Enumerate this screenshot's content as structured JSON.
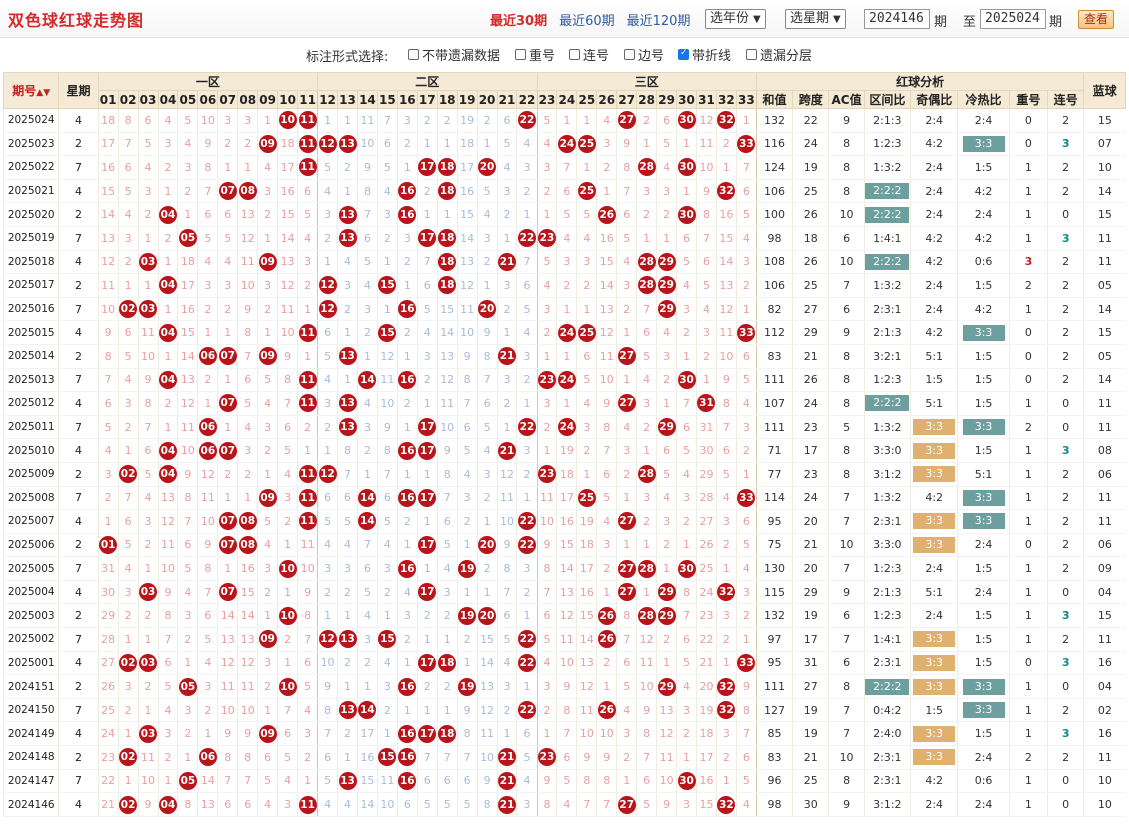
{
  "title": "双色球红球走势图",
  "toplinks": [
    "最近30期",
    "最近60期",
    "最近120期"
  ],
  "year_select": "选年份",
  "week_select": "选星期",
  "from_issue": "2024146",
  "issue_suffix": "期",
  "to_label": "至",
  "to_issue": "2025024",
  "view_button": "查看",
  "options_label": "标注形式选择:",
  "options": [
    {
      "label": "不带遗漏数据",
      "checked": false
    },
    {
      "label": "重号",
      "checked": false
    },
    {
      "label": "连号",
      "checked": false
    },
    {
      "label": "边号",
      "checked": false
    },
    {
      "label": "带折线",
      "checked": true
    },
    {
      "label": "遗漏分层",
      "checked": false
    }
  ],
  "headers": {
    "issue": "期号",
    "week": "星期",
    "zone1": "一区",
    "zone2": "二区",
    "zone3": "三区",
    "analysis": "红球分析",
    "blue": "蓝球",
    "an_cols": [
      "和值",
      "跨度",
      "AC值",
      "区间比",
      "奇偶比",
      "冷热比",
      "重号",
      "连号"
    ]
  },
  "rows": [
    {
      "issue": "2025024",
      "week": "4",
      "red": [
        10,
        11,
        22,
        27,
        30,
        32
      ],
      "sum": "132",
      "span": "22",
      "ac": "9",
      "zone": "2:1:3",
      "oe": "2:4",
      "ch": "2:4",
      "rep": "0",
      "con": "2",
      "blue": "15"
    },
    {
      "issue": "2025023",
      "week": "2",
      "red": [
        9,
        11,
        12,
        13,
        24,
        25,
        33
      ],
      "sum": "116",
      "span": "24",
      "ac": "8",
      "zone": "1:2:3",
      "oe": "4:2",
      "ch": "3:3",
      "rep": "0",
      "con": "3",
      "blue": "07"
    },
    {
      "issue": "2025022",
      "week": "7",
      "red": [
        11,
        17,
        18,
        20,
        28,
        30
      ],
      "sum": "124",
      "span": "19",
      "ac": "8",
      "zone": "1:3:2",
      "oe": "2:4",
      "ch": "1:5",
      "rep": "1",
      "con": "2",
      "blue": "10"
    },
    {
      "issue": "2025021",
      "week": "4",
      "red": [
        7,
        8,
        16,
        18,
        25,
        32
      ],
      "sum": "106",
      "span": "25",
      "ac": "8",
      "zone": "2:2:2",
      "oe": "2:4",
      "ch": "4:2",
      "rep": "1",
      "con": "2",
      "blue": "14"
    },
    {
      "issue": "2025020",
      "week": "2",
      "red": [
        4,
        13,
        16,
        26,
        30
      ],
      "sum": "100",
      "span": "26",
      "ac": "10",
      "zone": "2:2:2",
      "oe": "2:4",
      "ch": "2:4",
      "rep": "1",
      "con": "0",
      "blue": "15"
    },
    {
      "issue": "2025019",
      "week": "7",
      "red": [
        5,
        13,
        17,
        18,
        22,
        23
      ],
      "sum": "98",
      "span": "18",
      "ac": "6",
      "zone": "1:4:1",
      "oe": "4:2",
      "ch": "4:2",
      "rep": "1",
      "con": "3",
      "blue": "11"
    },
    {
      "issue": "2025018",
      "week": "4",
      "red": [
        3,
        9,
        18,
        21,
        28,
        29
      ],
      "sum": "108",
      "span": "26",
      "ac": "10",
      "zone": "2:2:2",
      "oe": "4:2",
      "ch": "0:6",
      "rep": "3",
      "con": "2",
      "blue": "11"
    },
    {
      "issue": "2025017",
      "week": "2",
      "red": [
        4,
        12,
        15,
        18,
        28,
        29
      ],
      "sum": "106",
      "span": "25",
      "ac": "7",
      "zone": "1:3:2",
      "oe": "2:4",
      "ch": "1:5",
      "rep": "2",
      "con": "2",
      "blue": "05"
    },
    {
      "issue": "2025016",
      "week": "7",
      "red": [
        2,
        3,
        12,
        16,
        20,
        29
      ],
      "sum": "82",
      "span": "27",
      "ac": "6",
      "zone": "2:3:1",
      "oe": "2:4",
      "ch": "4:2",
      "rep": "1",
      "con": "2",
      "blue": "14"
    },
    {
      "issue": "2025015",
      "week": "4",
      "red": [
        4,
        11,
        15,
        24,
        25,
        33
      ],
      "sum": "112",
      "span": "29",
      "ac": "9",
      "zone": "2:1:3",
      "oe": "4:2",
      "ch": "3:3",
      "rep": "0",
      "con": "2",
      "blue": "15"
    },
    {
      "issue": "2025014",
      "week": "2",
      "red": [
        6,
        7,
        9,
        13,
        21,
        27
      ],
      "sum": "83",
      "span": "21",
      "ac": "8",
      "zone": "3:2:1",
      "oe": "5:1",
      "ch": "1:5",
      "rep": "0",
      "con": "2",
      "blue": "05"
    },
    {
      "issue": "2025013",
      "week": "7",
      "red": [
        4,
        11,
        14,
        16,
        23,
        24,
        30
      ],
      "sum": "111",
      "span": "26",
      "ac": "8",
      "zone": "1:2:3",
      "oe": "1:5",
      "ch": "1:5",
      "rep": "0",
      "con": "2",
      "blue": "14"
    },
    {
      "issue": "2025012",
      "week": "4",
      "red": [
        7,
        11,
        13,
        27,
        31
      ],
      "sum": "107",
      "span": "24",
      "ac": "8",
      "zone": "2:2:2",
      "oe": "5:1",
      "ch": "1:5",
      "rep": "1",
      "con": "0",
      "blue": "11"
    },
    {
      "issue": "2025011",
      "week": "7",
      "red": [
        6,
        13,
        17,
        22,
        24,
        29
      ],
      "sum": "111",
      "span": "23",
      "ac": "5",
      "zone": "1:3:2",
      "oe": "3:3",
      "ch": "3:3",
      "rep": "2",
      "con": "0",
      "blue": "11"
    },
    {
      "issue": "2025010",
      "week": "4",
      "red": [
        4,
        6,
        7,
        16,
        17,
        21
      ],
      "sum": "71",
      "span": "17",
      "ac": "8",
      "zone": "3:3:0",
      "oe": "3:3",
      "ch": "1:5",
      "rep": "1",
      "con": "3",
      "blue": "08"
    },
    {
      "issue": "2025009",
      "week": "2",
      "red": [
        2,
        4,
        11,
        12,
        23,
        28
      ],
      "sum": "77",
      "span": "23",
      "ac": "8",
      "zone": "3:1:2",
      "oe": "3:3",
      "ch": "5:1",
      "rep": "1",
      "con": "2",
      "blue": "06"
    },
    {
      "issue": "2025008",
      "week": "7",
      "red": [
        9,
        11,
        14,
        16,
        17,
        25,
        33
      ],
      "sum": "114",
      "span": "24",
      "ac": "7",
      "zone": "1:3:2",
      "oe": "4:2",
      "ch": "3:3",
      "rep": "1",
      "con": "2",
      "blue": "11"
    },
    {
      "issue": "2025007",
      "week": "4",
      "red": [
        7,
        8,
        11,
        14,
        22,
        27
      ],
      "sum": "95",
      "span": "20",
      "ac": "7",
      "zone": "2:3:1",
      "oe": "3:3",
      "ch": "3:3",
      "rep": "1",
      "con": "2",
      "blue": "11"
    },
    {
      "issue": "2025006",
      "week": "2",
      "red": [
        1,
        7,
        8,
        17,
        20,
        22
      ],
      "sum": "75",
      "span": "21",
      "ac": "10",
      "zone": "3:3:0",
      "oe": "3:3",
      "ch": "2:4",
      "rep": "0",
      "con": "2",
      "blue": "06"
    },
    {
      "issue": "2025005",
      "week": "7",
      "red": [
        10,
        16,
        19,
        27,
        28,
        30
      ],
      "sum": "130",
      "span": "20",
      "ac": "7",
      "zone": "1:2:3",
      "oe": "2:4",
      "ch": "1:5",
      "rep": "1",
      "con": "2",
      "blue": "09"
    },
    {
      "issue": "2025004",
      "week": "4",
      "red": [
        3,
        7,
        17,
        27,
        29,
        32
      ],
      "sum": "115",
      "span": "29",
      "ac": "9",
      "zone": "2:1:3",
      "oe": "5:1",
      "ch": "2:4",
      "rep": "1",
      "con": "0",
      "blue": "04"
    },
    {
      "issue": "2025003",
      "week": "2",
      "red": [
        10,
        19,
        20,
        26,
        28,
        29
      ],
      "sum": "132",
      "span": "19",
      "ac": "6",
      "zone": "1:2:3",
      "oe": "2:4",
      "ch": "1:5",
      "rep": "1",
      "con": "3",
      "blue": "15"
    },
    {
      "issue": "2025002",
      "week": "7",
      "red": [
        9,
        12,
        13,
        15,
        22,
        26
      ],
      "sum": "97",
      "span": "17",
      "ac": "7",
      "zone": "1:4:1",
      "oe": "3:3",
      "ch": "1:5",
      "rep": "1",
      "con": "2",
      "blue": "11"
    },
    {
      "issue": "2025001",
      "week": "4",
      "red": [
        2,
        3,
        17,
        18,
        22,
        33
      ],
      "sum": "95",
      "span": "31",
      "ac": "6",
      "zone": "2:3:1",
      "oe": "3:3",
      "ch": "1:5",
      "rep": "0",
      "con": "3",
      "blue": "16"
    },
    {
      "issue": "2024151",
      "week": "2",
      "red": [
        5,
        10,
        16,
        19,
        29,
        32
      ],
      "sum": "111",
      "span": "27",
      "ac": "8",
      "zone": "2:2:2",
      "oe": "3:3",
      "ch": "3:3",
      "rep": "1",
      "con": "0",
      "blue": "04"
    },
    {
      "issue": "2024150",
      "week": "7",
      "red": [
        13,
        14,
        22,
        26,
        32
      ],
      "sum": "127",
      "span": "19",
      "ac": "7",
      "zone": "0:4:2",
      "oe": "1:5",
      "ch": "3:3",
      "rep": "1",
      "con": "2",
      "blue": "02"
    },
    {
      "issue": "2024149",
      "week": "4",
      "red": [
        3,
        9,
        16,
        17,
        18
      ],
      "sum": "85",
      "span": "19",
      "ac": "7",
      "zone": "2:4:0",
      "oe": "3:3",
      "ch": "1:5",
      "rep": "1",
      "con": "3",
      "blue": "16"
    },
    {
      "issue": "2024148",
      "week": "2",
      "red": [
        2,
        6,
        15,
        16,
        21,
        23
      ],
      "sum": "83",
      "span": "21",
      "ac": "10",
      "zone": "2:3:1",
      "oe": "3:3",
      "ch": "2:4",
      "rep": "2",
      "con": "2",
      "blue": "11"
    },
    {
      "issue": "2024147",
      "week": "7",
      "red": [
        5,
        13,
        16,
        21,
        30
      ],
      "sum": "96",
      "span": "25",
      "ac": "8",
      "zone": "2:3:1",
      "oe": "4:2",
      "ch": "0:6",
      "rep": "1",
      "con": "0",
      "blue": "10"
    },
    {
      "issue": "2024146",
      "week": "4",
      "red": [
        2,
        4,
        11,
        21,
        27,
        32
      ],
      "sum": "98",
      "span": "30",
      "ac": "9",
      "zone": "3:1:2",
      "oe": "2:4",
      "ch": "2:4",
      "rep": "1",
      "con": "0",
      "blue": "10"
    }
  ]
}
